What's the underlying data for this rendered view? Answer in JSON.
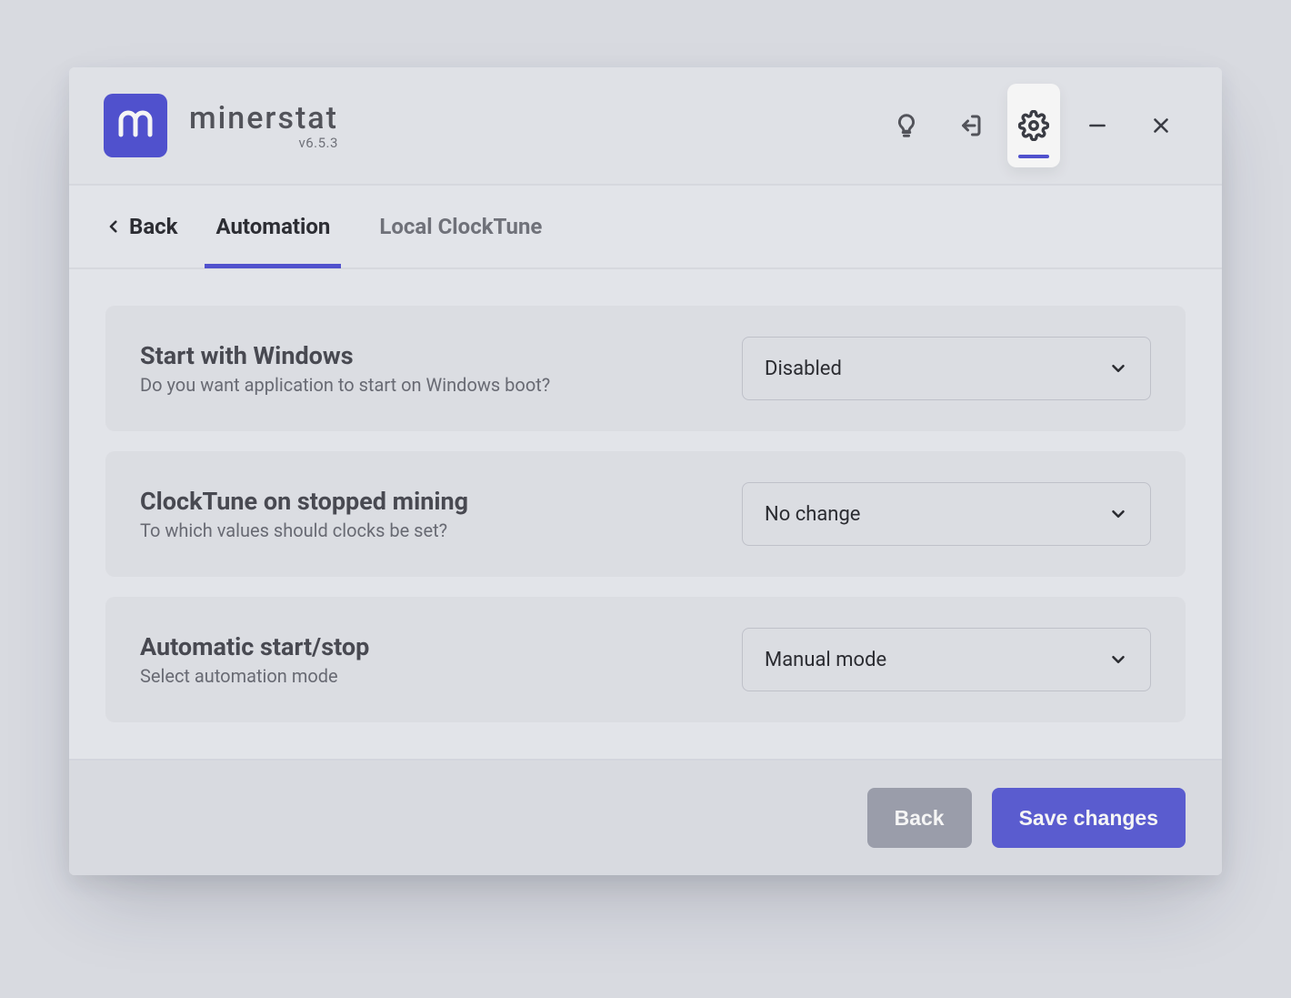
{
  "brand": {
    "name": "minerstat",
    "version": "v6.5.3"
  },
  "nav": {
    "back": "Back"
  },
  "tabs": [
    {
      "label": "Automation",
      "active": true
    },
    {
      "label": "Local ClockTune",
      "active": false
    }
  ],
  "settings": [
    {
      "title": "Start with Windows",
      "desc": "Do you want application to start on Windows boot?",
      "value": "Disabled"
    },
    {
      "title": "ClockTune on stopped mining",
      "desc": "To which values should clocks be set?",
      "value": "No change"
    },
    {
      "title": "Automatic start/stop",
      "desc": "Select automation mode",
      "value": "Manual mode"
    }
  ],
  "footer": {
    "back": "Back",
    "save": "Save changes"
  }
}
